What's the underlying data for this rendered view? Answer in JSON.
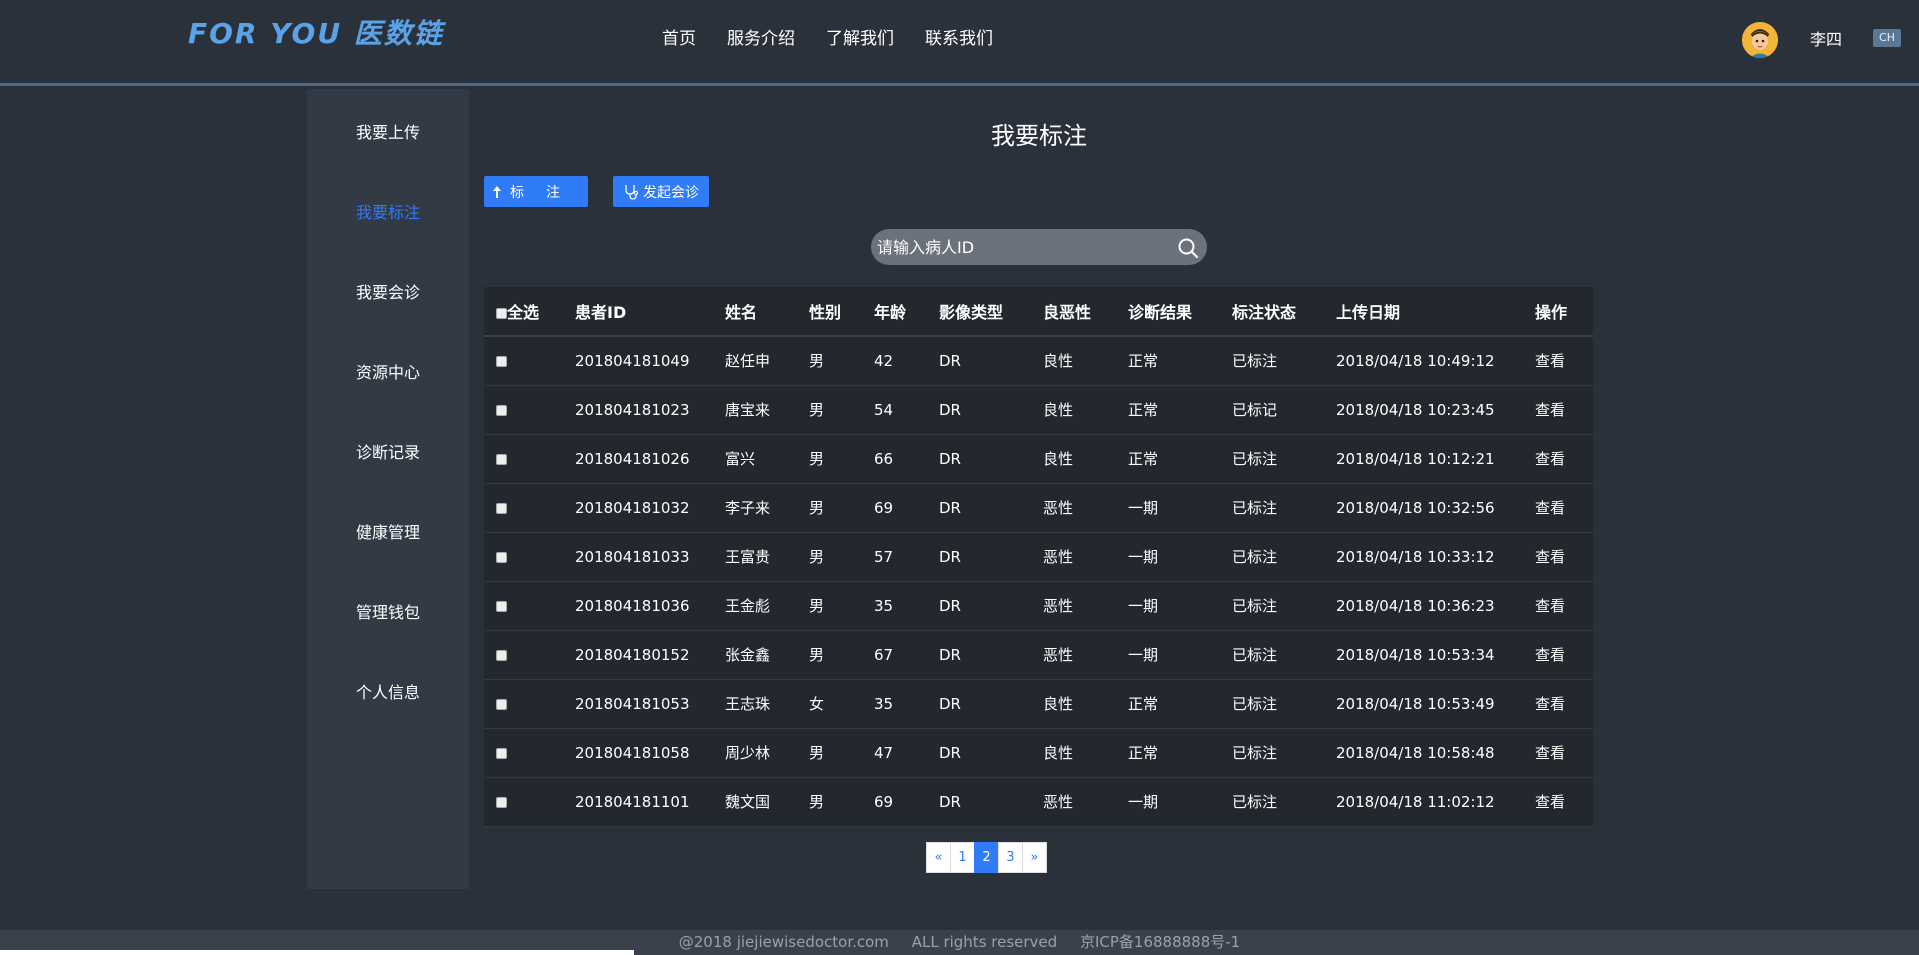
{
  "header": {
    "logo": "FOR YOU 医数链",
    "nav": [
      "首页",
      "服务介绍",
      "了解我们",
      "联系我们"
    ],
    "user": "李四",
    "lang": "CH"
  },
  "sidebar": {
    "items": [
      "我要上传",
      "我要标注",
      "我要会诊",
      "资源中心",
      "诊断记录",
      "健康管理",
      "管理钱包",
      "个人信息"
    ],
    "active_index": 1
  },
  "main": {
    "title": "我要标注",
    "mark_button": "标注",
    "consult_button": "发起会诊",
    "search_placeholder": "请输入病人ID"
  },
  "table": {
    "columns": [
      "全选",
      "患者ID",
      "姓名",
      "性别",
      "年龄",
      "影像类型",
      "良恶性",
      "诊断结果",
      "标注状态",
      "上传日期",
      "操作"
    ],
    "rows": [
      {
        "id": "201804181049",
        "name": "赵任申",
        "sex": "男",
        "age": "42",
        "img": "DR",
        "benign": "良性",
        "dx": "正常",
        "status": "已标注",
        "date": "2018/04/18 10:49:12",
        "action": "查看"
      },
      {
        "id": "201804181023",
        "name": "唐宝来",
        "sex": "男",
        "age": "54",
        "img": "DR",
        "benign": "良性",
        "dx": "正常",
        "status": "已标记",
        "date": "2018/04/18 10:23:45",
        "action": "查看"
      },
      {
        "id": "201804181026",
        "name": "富兴",
        "sex": "男",
        "age": "66",
        "img": "DR",
        "benign": "良性",
        "dx": "正常",
        "status": "已标注",
        "date": "2018/04/18 10:12:21",
        "action": "查看"
      },
      {
        "id": "201804181032",
        "name": "李子来",
        "sex": "男",
        "age": "69",
        "img": "DR",
        "benign": "恶性",
        "dx": "一期",
        "status": "已标注",
        "date": "2018/04/18 10:32:56",
        "action": "查看"
      },
      {
        "id": "201804181033",
        "name": "王富贵",
        "sex": "男",
        "age": "57",
        "img": "DR",
        "benign": "恶性",
        "dx": "一期",
        "status": "已标注",
        "date": "2018/04/18 10:33:12",
        "action": "查看"
      },
      {
        "id": "201804181036",
        "name": "王金彪",
        "sex": "男",
        "age": "35",
        "img": "DR",
        "benign": "恶性",
        "dx": "一期",
        "status": "已标注",
        "date": "2018/04/18 10:36:23",
        "action": "查看"
      },
      {
        "id": "201804180152",
        "name": "张金鑫",
        "sex": "男",
        "age": "67",
        "img": "DR",
        "benign": "恶性",
        "dx": "一期",
        "status": "已标注",
        "date": "2018/04/18 10:53:34",
        "action": "查看"
      },
      {
        "id": "201804181053",
        "name": "王志珠",
        "sex": "女",
        "age": "35",
        "img": "DR",
        "benign": "良性",
        "dx": "正常",
        "status": "已标注",
        "date": "2018/04/18 10:53:49",
        "action": "查看"
      },
      {
        "id": "201804181058",
        "name": "周少林",
        "sex": "男",
        "age": "47",
        "img": "DR",
        "benign": "良性",
        "dx": "正常",
        "status": "已标注",
        "date": "2018/04/18 10:58:48",
        "action": "查看"
      },
      {
        "id": "201804181101",
        "name": "魏文国",
        "sex": "男",
        "age": "69",
        "img": "DR",
        "benign": "恶性",
        "dx": "一期",
        "status": "已标注",
        "date": "2018/04/18 11:02:12",
        "action": "查看"
      }
    ]
  },
  "pagination": {
    "prev": "«",
    "pages": [
      "1",
      "2",
      "3"
    ],
    "current": "2",
    "next": "»"
  },
  "footer": {
    "copyright": "@2018 jiejiewisedoctor.com",
    "rights": "ALL rights reserved",
    "icp": "京ICP备16888888号-1"
  },
  "icons": {
    "mark": "upload-arrow-icon",
    "consult": "stethoscope-icon",
    "search": "search-icon"
  },
  "colors": {
    "accent": "#2f7cf6",
    "background": "#2b313a",
    "sidebar": "#323a45",
    "table": "#23272e"
  }
}
